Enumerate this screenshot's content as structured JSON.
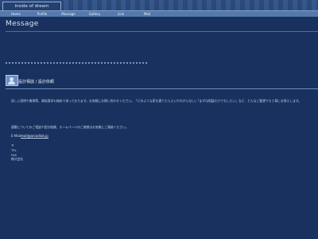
{
  "header": {
    "logo_text": "inside of dream",
    "nav_items": [
      "Home",
      "Profile",
      "Message",
      "Gallery",
      "Link",
      "Mail"
    ]
  },
  "page": {
    "title": "Message",
    "heading_left": "設計相談",
    "heading_sep": "/",
    "heading_right": "設計依頼",
    "paragraph_1": "詳しい説明や質問等、資料請求も無料で承っております。お気軽にお問い合わせください。「どのような家を建てたらよいかわからない」「まずは相談だけでもしたい」など、どんなご要望でも丁寧にお答えします。",
    "paragraph_2": "建築についてのご相談や設計依頼、ホームページのご感想はお気軽にご連絡ください。",
    "mail_label": "E-Mail :",
    "mail_address": "mail@arcadlab.jp",
    "address_lines": [
      "〒",
      "TEL",
      "FAX",
      "株式会社"
    ]
  }
}
